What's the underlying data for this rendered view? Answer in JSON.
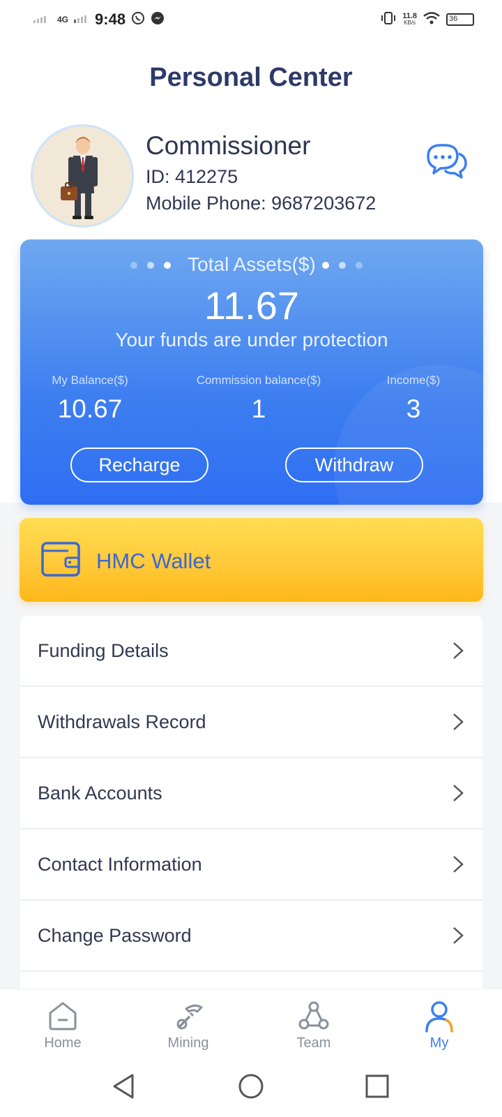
{
  "status_bar": {
    "network": "4G",
    "time": "9:48",
    "speed_value": "11.8",
    "speed_unit": "KB/s",
    "battery": "36",
    "icons": [
      "whatsapp-icon",
      "messenger-icon",
      "vibrate-icon",
      "wifi-icon",
      "battery-icon"
    ]
  },
  "header": {
    "title": "Personal Center"
  },
  "profile": {
    "name": "Commissioner",
    "id": "ID: 412275",
    "phone": "Mobile Phone: 9687203672",
    "chat_icon": "chat-bubbles-icon"
  },
  "assets": {
    "title": "Total Assets($)",
    "total": "11.67",
    "note": "Your funds are under protection",
    "stats": [
      {
        "label": "My Balance($)",
        "value": "10.67"
      },
      {
        "label": "Commission balance($)",
        "value": "1"
      },
      {
        "label": "Income($)",
        "value": "3"
      }
    ],
    "recharge_label": "Recharge",
    "withdraw_label": "Withdraw"
  },
  "wallet": {
    "label": "HMC Wallet",
    "icon": "wallet-icon"
  },
  "menu": {
    "items": [
      {
        "label": "Funding Details"
      },
      {
        "label": "Withdrawals Record"
      },
      {
        "label": "Bank Accounts"
      },
      {
        "label": "Contact Information"
      },
      {
        "label": "Change Password"
      }
    ]
  },
  "tabbar": {
    "tabs": [
      {
        "label": "Home",
        "icon": "home-icon"
      },
      {
        "label": "Mining",
        "icon": "mining-icon"
      },
      {
        "label": "Team",
        "icon": "team-icon"
      },
      {
        "label": "My",
        "icon": "user-icon"
      }
    ],
    "active": "My"
  },
  "colors": {
    "title": "#2e3a68",
    "card_blue": "#3d7ef0",
    "wallet_yellow": "#ffc93a",
    "active_tab": "#3b7ff0"
  }
}
